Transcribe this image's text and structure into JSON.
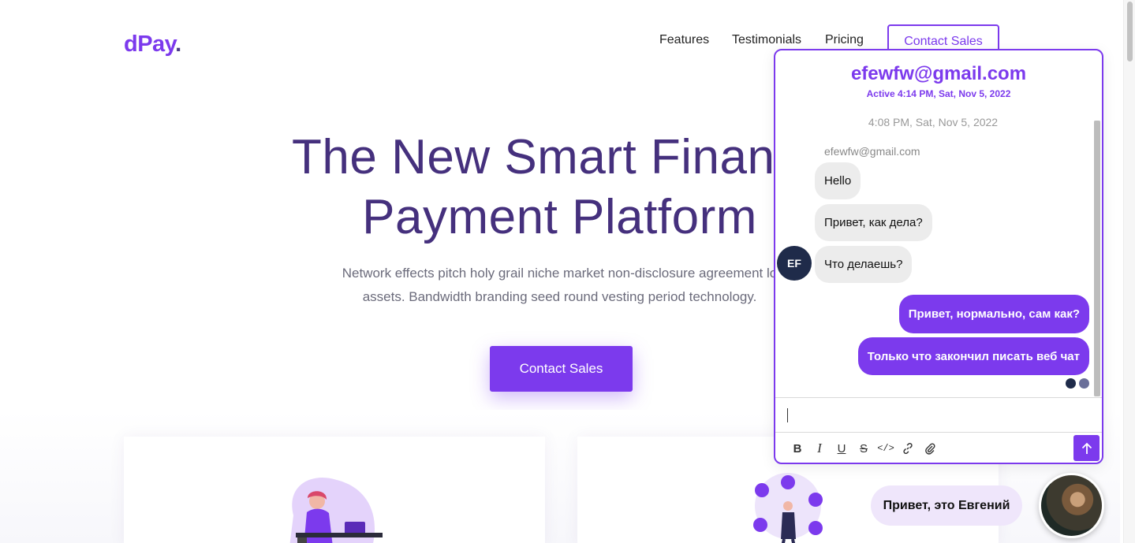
{
  "nav": {
    "logo": "dPay",
    "logo_dot": ".",
    "links": [
      "Features",
      "Testimonials",
      "Pricing"
    ],
    "cta": "Contact Sales"
  },
  "hero": {
    "title_line1": "The New Smart Finance",
    "title_line2": "Payment Platform",
    "subtitle_line1": "Network effects pitch holy grail niche market non-disclosure agreement lo",
    "subtitle_line2": "assets. Bandwidth branding seed round vesting period technology.",
    "cta": "Contact Sales"
  },
  "chat": {
    "title": "efewfw@gmail.com",
    "status": "Active 4:14 PM, Sat, Nov 5, 2022",
    "timestamp": "4:08 PM, Sat, Nov 5, 2022",
    "sender": "efewfw@gmail.com",
    "avatar_initials": "EF",
    "messages": [
      {
        "dir": "in",
        "text": "Hello"
      },
      {
        "dir": "in",
        "text": "Привет, как дела?"
      },
      {
        "dir": "in",
        "text": "Что делаешь?"
      },
      {
        "dir": "out",
        "text": "Привет, нормально, сам как?"
      },
      {
        "dir": "out",
        "text": "Только что закончил писать веб чат"
      }
    ],
    "input_value": "",
    "toolbar": [
      "B",
      "I",
      "U",
      "S"
    ]
  },
  "greeting": "Привет, это Евгений",
  "colors": {
    "accent": "#7c3aed",
    "title": "#45307d",
    "avatar_bg": "#1f2b4a"
  }
}
